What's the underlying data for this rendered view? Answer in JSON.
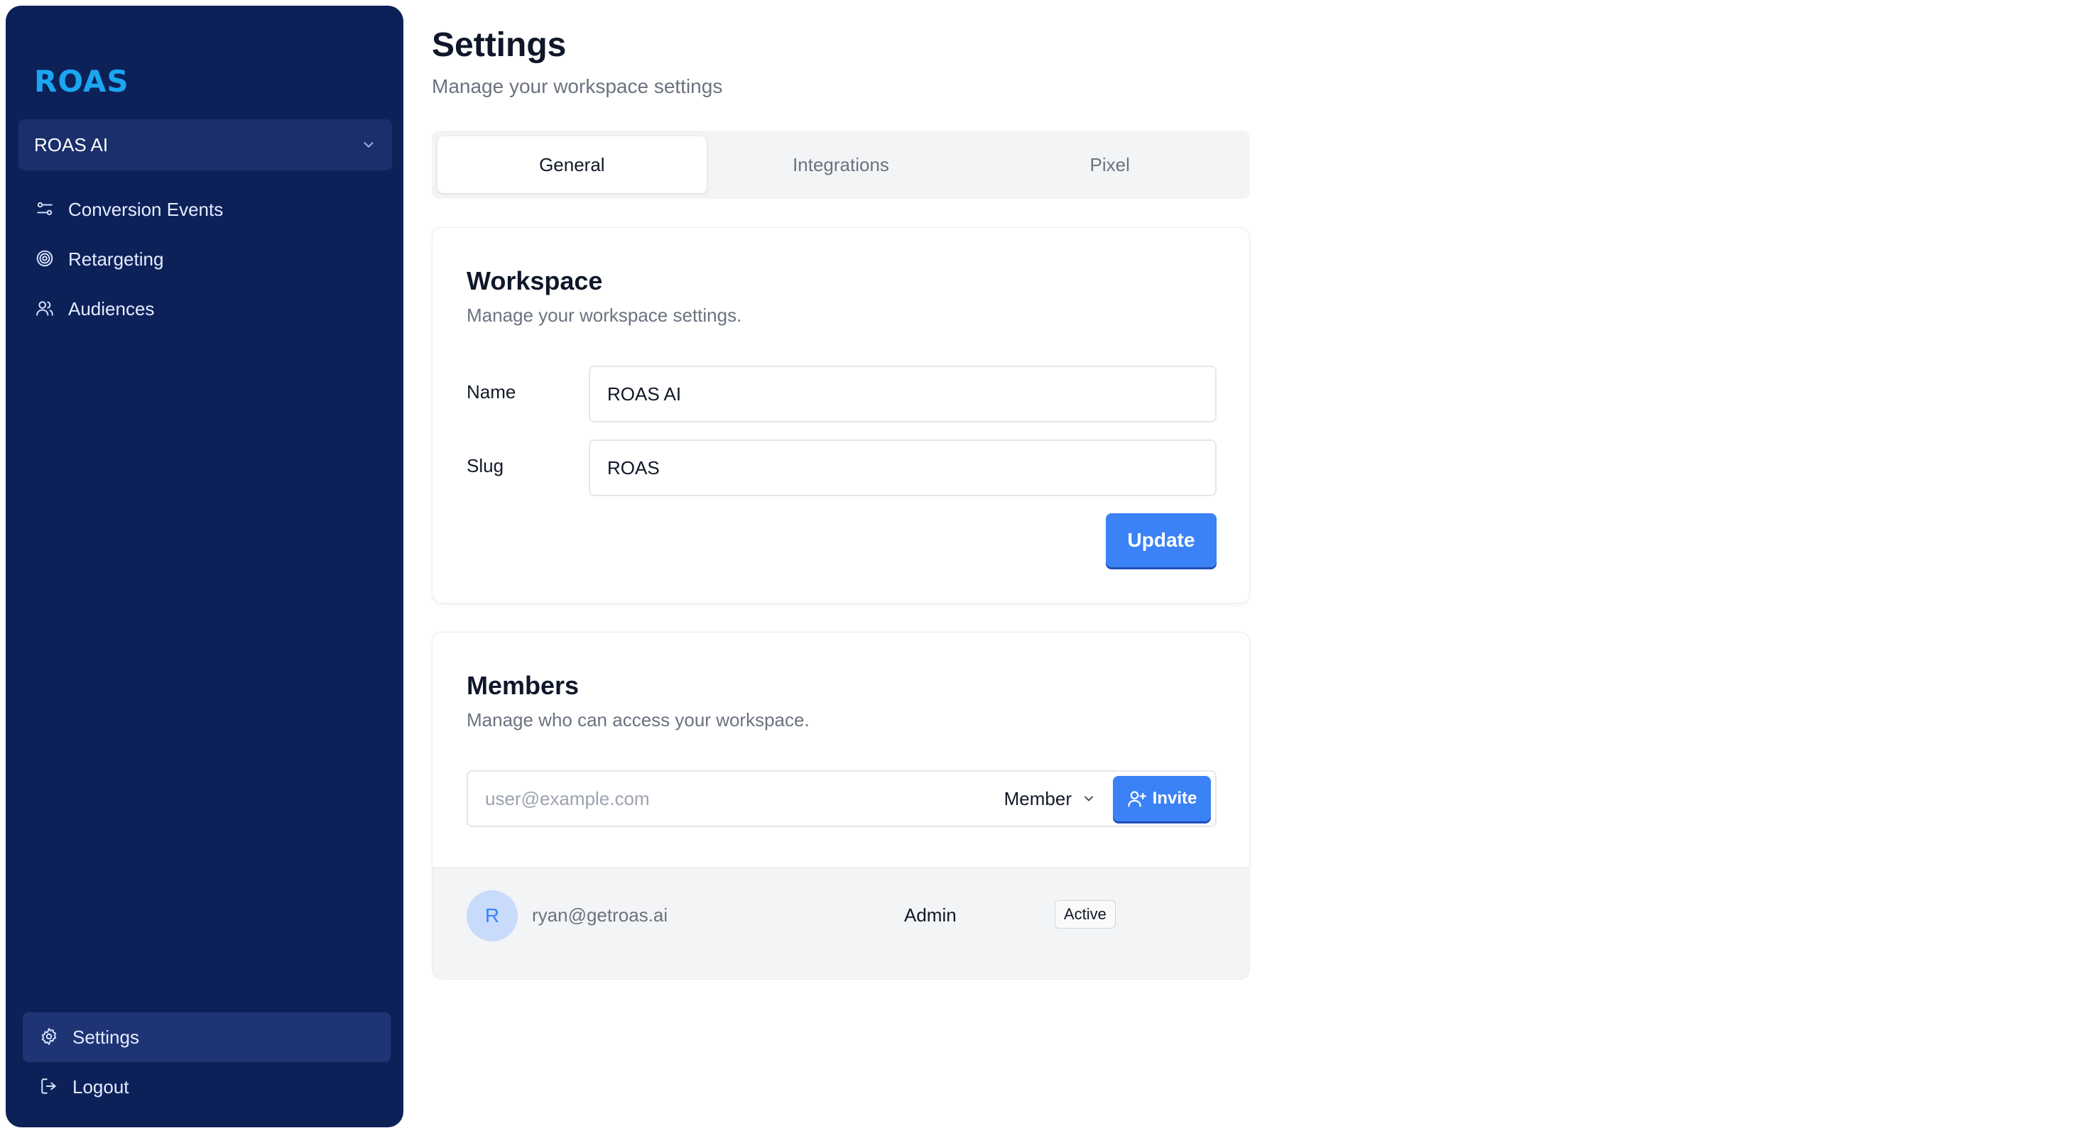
{
  "brand": {
    "logo_text": "ROAS",
    "accent": "#1ba6f0",
    "sidebar_bg": "#0d2159"
  },
  "sidebar": {
    "workspace_select": "ROAS AI",
    "items": [
      {
        "label": "Conversion Events",
        "icon": "sliders-icon"
      },
      {
        "label": "Retargeting",
        "icon": "target-icon"
      },
      {
        "label": "Audiences",
        "icon": "users-icon"
      }
    ],
    "bottom_items": [
      {
        "label": "Settings",
        "icon": "gear-icon",
        "active": true
      },
      {
        "label": "Logout",
        "icon": "logout-icon"
      }
    ]
  },
  "header": {
    "title": "Settings",
    "subtitle": "Manage your workspace settings"
  },
  "tabs": [
    {
      "label": "General",
      "active": true
    },
    {
      "label": "Integrations"
    },
    {
      "label": "Pixel"
    }
  ],
  "workspace": {
    "title": "Workspace",
    "subtitle": "Manage your workspace settings.",
    "name_label": "Name",
    "name_value": "ROAS AI",
    "slug_label": "Slug",
    "slug_value": "ROAS",
    "update_label": "Update"
  },
  "members": {
    "title": "Members",
    "subtitle": "Manage who can access your workspace.",
    "email_placeholder": "user@example.com",
    "role_selected": "Member",
    "invite_label": "Invite",
    "list": [
      {
        "initial": "R",
        "email": "ryan@getroas.ai",
        "role": "Admin",
        "status": "Active"
      }
    ]
  },
  "colors": {
    "primary_button": "#3b82f6",
    "avatar_bg": "#c8dbfb"
  }
}
